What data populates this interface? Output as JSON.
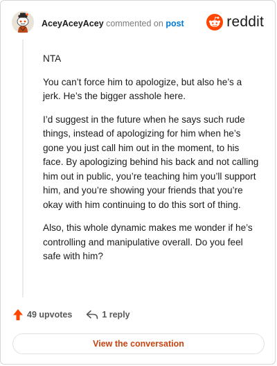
{
  "header": {
    "username": "AceyAceyAcey",
    "action_text": "commented on",
    "post_link": "post",
    "brand": "reddit"
  },
  "comment": {
    "paragraphs": [
      "NTA",
      "You can’t force him to apologize, but also he’s a jerk. He’s the bigger asshole here.",
      "I’d suggest in the future when he says such rude things, instead of apologizing for him when he’s gone you just call him out in the moment, to his face. By apologizing behind his back and not calling him out in public, you’re teaching him you’ll support him, and you’re showing your friends that you’re okay with him continuing to do this sort of thing.",
      "Also, this whole dynamic makes me wonder if he’s controlling and manipulative overall. Do you feel safe with him?"
    ]
  },
  "actions": {
    "upvotes": "49 upvotes",
    "replies": "1 reply"
  },
  "footer": {
    "view_button": "View the conversation"
  },
  "icons": {
    "avatar": "snoo-avatar",
    "logo": "reddit-snoo-icon",
    "upvote": "upvote-arrow-icon",
    "reply": "reply-arrow-icon"
  },
  "colors": {
    "brand": "#ff4500",
    "link": "#0079d3",
    "button_text": "#c74410",
    "upvote": "#ff4500"
  }
}
